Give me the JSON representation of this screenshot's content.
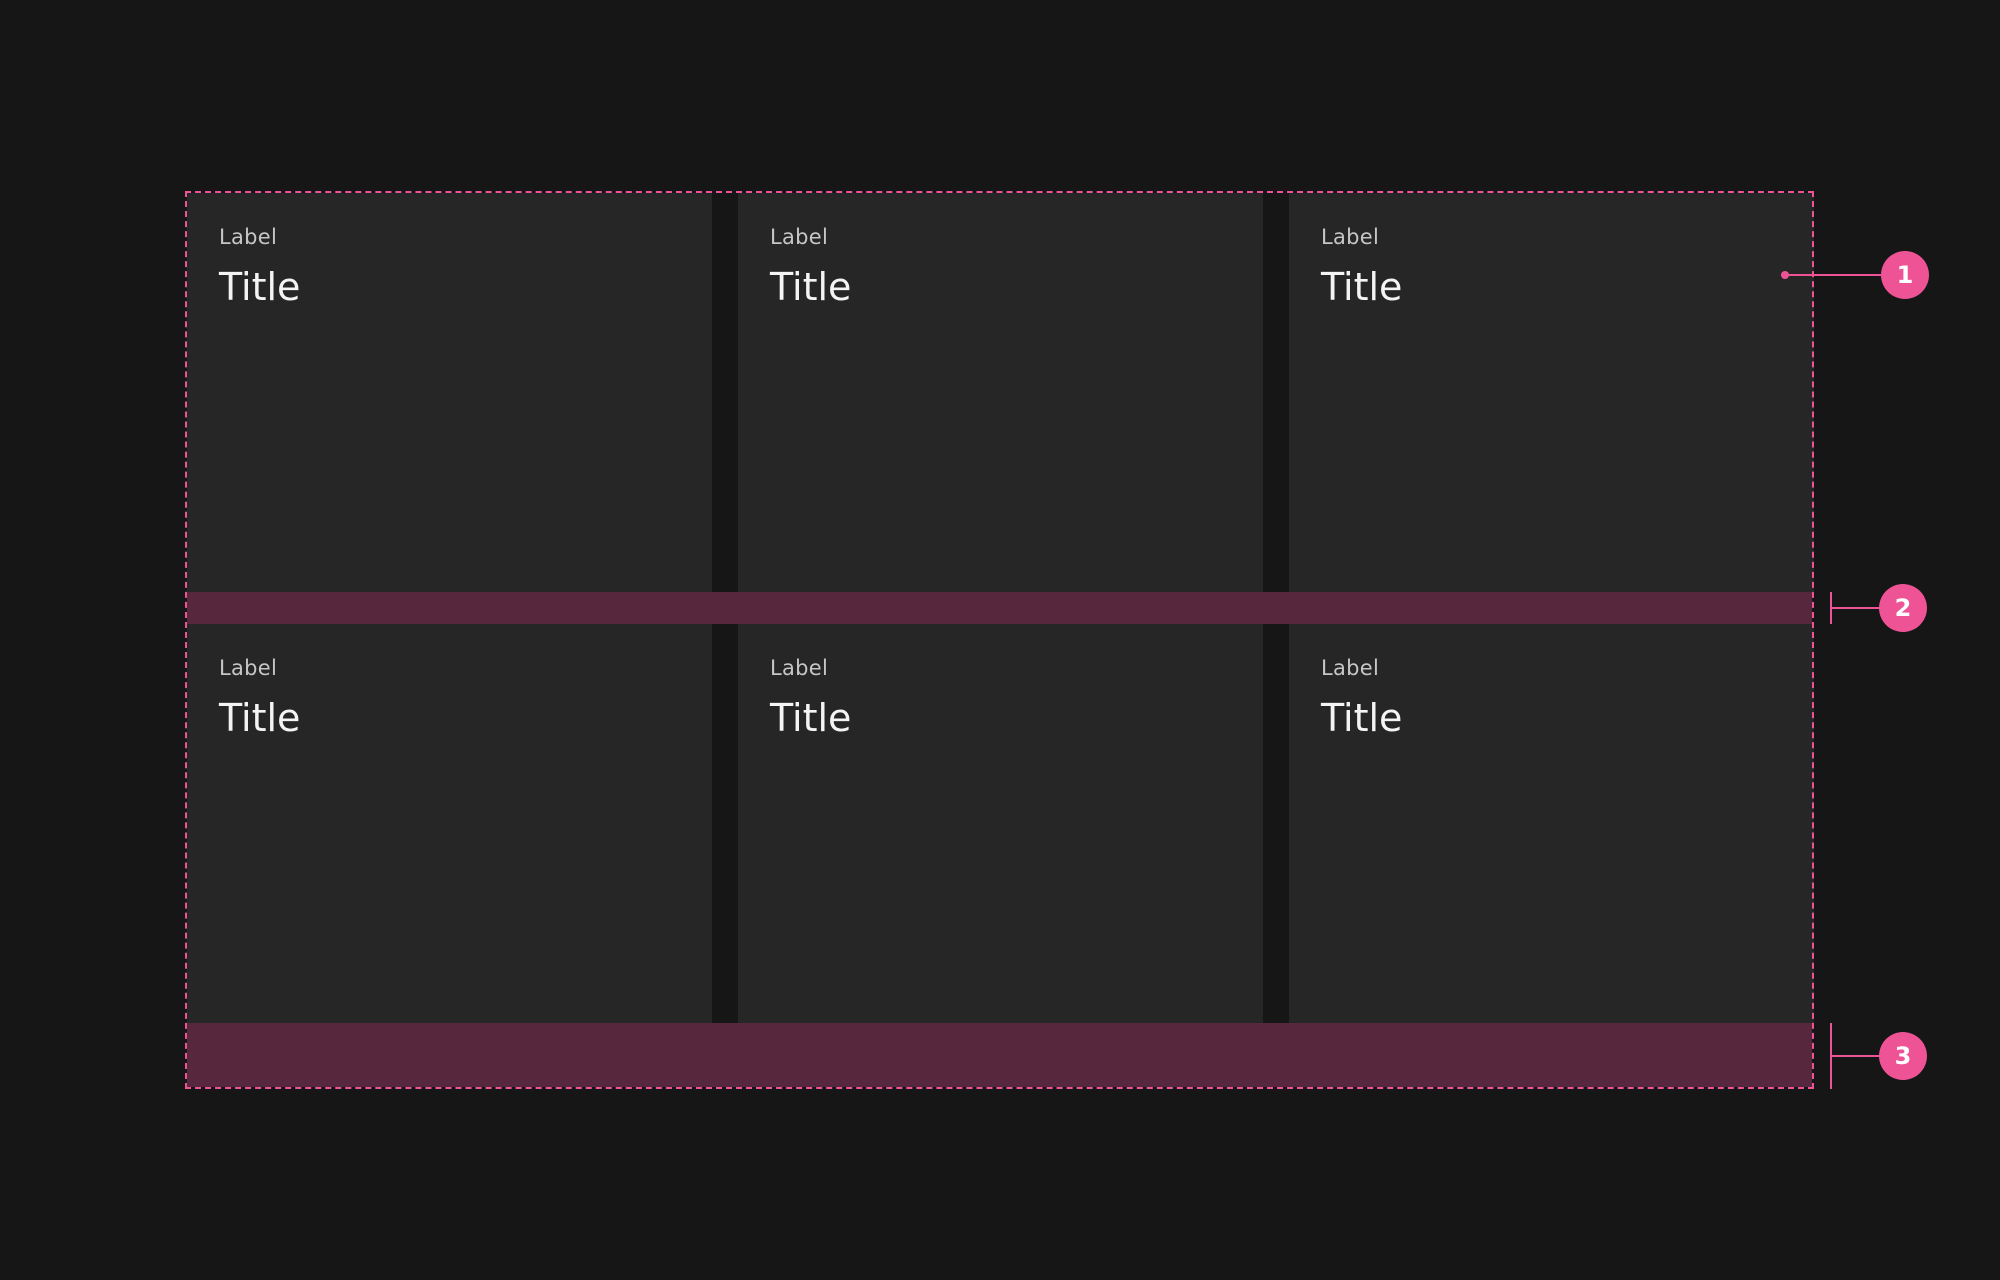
{
  "colors": {
    "background": "#161616",
    "tile": "#262626",
    "accent": "#ee5396",
    "band": "#57273e"
  },
  "tiles": [
    {
      "label": "Label",
      "title": "Title"
    },
    {
      "label": "Label",
      "title": "Title"
    },
    {
      "label": "Label",
      "title": "Title"
    },
    {
      "label": "Label",
      "title": "Title"
    },
    {
      "label": "Label",
      "title": "Title"
    },
    {
      "label": "Label",
      "title": "Title"
    }
  ],
  "callouts": [
    "1",
    "2",
    "3"
  ]
}
